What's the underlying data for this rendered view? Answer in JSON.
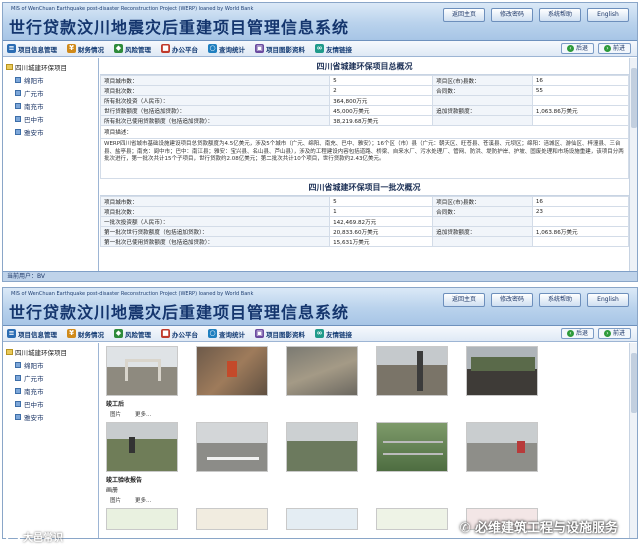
{
  "header": {
    "subtitle": "MIS of WenChuan Earthquake post-disaster Reconstruction Project (WERP) loaned by World Bank",
    "title": "世行贷款汶川地震灾后重建项目管理信息系统",
    "buttons": [
      "返回主页",
      "修改密码",
      "系统帮助",
      "English"
    ]
  },
  "menu": {
    "items": [
      {
        "label": "项目信息管理",
        "icon": "document-icon",
        "color": "#2b6cb3"
      },
      {
        "label": "财务情况",
        "icon": "money-icon",
        "color": "#d08a1a"
      },
      {
        "label": "风险管理",
        "icon": "shield-icon",
        "color": "#2e8b3b"
      },
      {
        "label": "办公平台",
        "icon": "briefcase-icon",
        "color": "#c0392b"
      },
      {
        "label": "查询统计",
        "icon": "magnifier-icon",
        "color": "#1f7fbf"
      },
      {
        "label": "项目图影资料",
        "icon": "camera-icon",
        "color": "#6a4aa0"
      },
      {
        "label": "友情链接",
        "icon": "link-icon",
        "color": "#1f9a8a"
      }
    ],
    "back": "后退",
    "forward": "前进"
  },
  "sidebar": {
    "root": "四川城建环保项目",
    "items": [
      "绵阳市",
      "广元市",
      "南充市",
      "巴中市",
      "雅安市"
    ]
  },
  "summary": {
    "title": "四川省城建环保项目总概况",
    "rows": [
      [
        "项目城市数：",
        "5",
        "项目区(市)县数：",
        "16"
      ],
      [
        "项目批次数：",
        "2",
        "合同数：",
        "55"
      ],
      [
        "所有批次投资（人民币）：",
        "364,800万元",
        "",
        ""
      ],
      [
        "世行贷款额度（包括追加贷款）：",
        "45,000万美元",
        "追加贷款额度：",
        "1,063.86万美元"
      ],
      [
        "所有批次已使用贷款额度（包括追加贷款）：",
        "38,219.68万美元",
        "",
        ""
      ]
    ],
    "desc_label": "项目描述：",
    "desc_text": "WERP四川省城市基础设施建设项目总贷款额度为4.5亿美元，涉及5个城市（广元、绵阳、南充、巴中、雅安）；16个区（市）县（广元：朝天区、旺苍县、苍溪县、元坝区；绵阳：涪城区、游仙区、梓潼县、三台县、盐亭县；南充：阆中市；巴中：南江县；雅安：宝兴县、名山县、芦山县），涉及的工程建设内容包括道路、桥梁、自来水厂、污水处理厂、管网、防洪、堤防护岸、护坡、固废处理和市场设施重建，该项目分两批次进行，第一批次共计15个子项目，世行贷款约2.08亿美元；第二批次共计10个项目，世行贷款约2.43亿美元。"
  },
  "batch1": {
    "title": "四川省城建环保项目一批次概况",
    "rows": [
      [
        "项目城市数：",
        "5",
        "项目区(市)县数：",
        "16"
      ],
      [
        "项目批次数：",
        "1",
        "合同数：",
        "23"
      ],
      [
        "一批次投资额（人民币）：",
        "142,469.82万元",
        "",
        ""
      ],
      [
        "第一批次世行贷款额度（包括追加贷款）：",
        "20,833.60万美元",
        "追加贷款额度：",
        "1,063.86万美元"
      ],
      [
        "第一批次已使用贷款额度（包括追加贷款）：",
        "15,631万美元",
        "",
        ""
      ]
    ]
  },
  "status": {
    "current_user": "当前用户：BV"
  },
  "gallery": {
    "section1_label": "竣工后",
    "section1_links": [
      "图片",
      "更多..."
    ],
    "section2_label": "竣工验收报告",
    "section2_sub": "画册",
    "section2_links": [
      "图片",
      "更多..."
    ]
  },
  "watermarks": {
    "left": "大邑常识",
    "right": "必维建筑工程与设施服务"
  }
}
